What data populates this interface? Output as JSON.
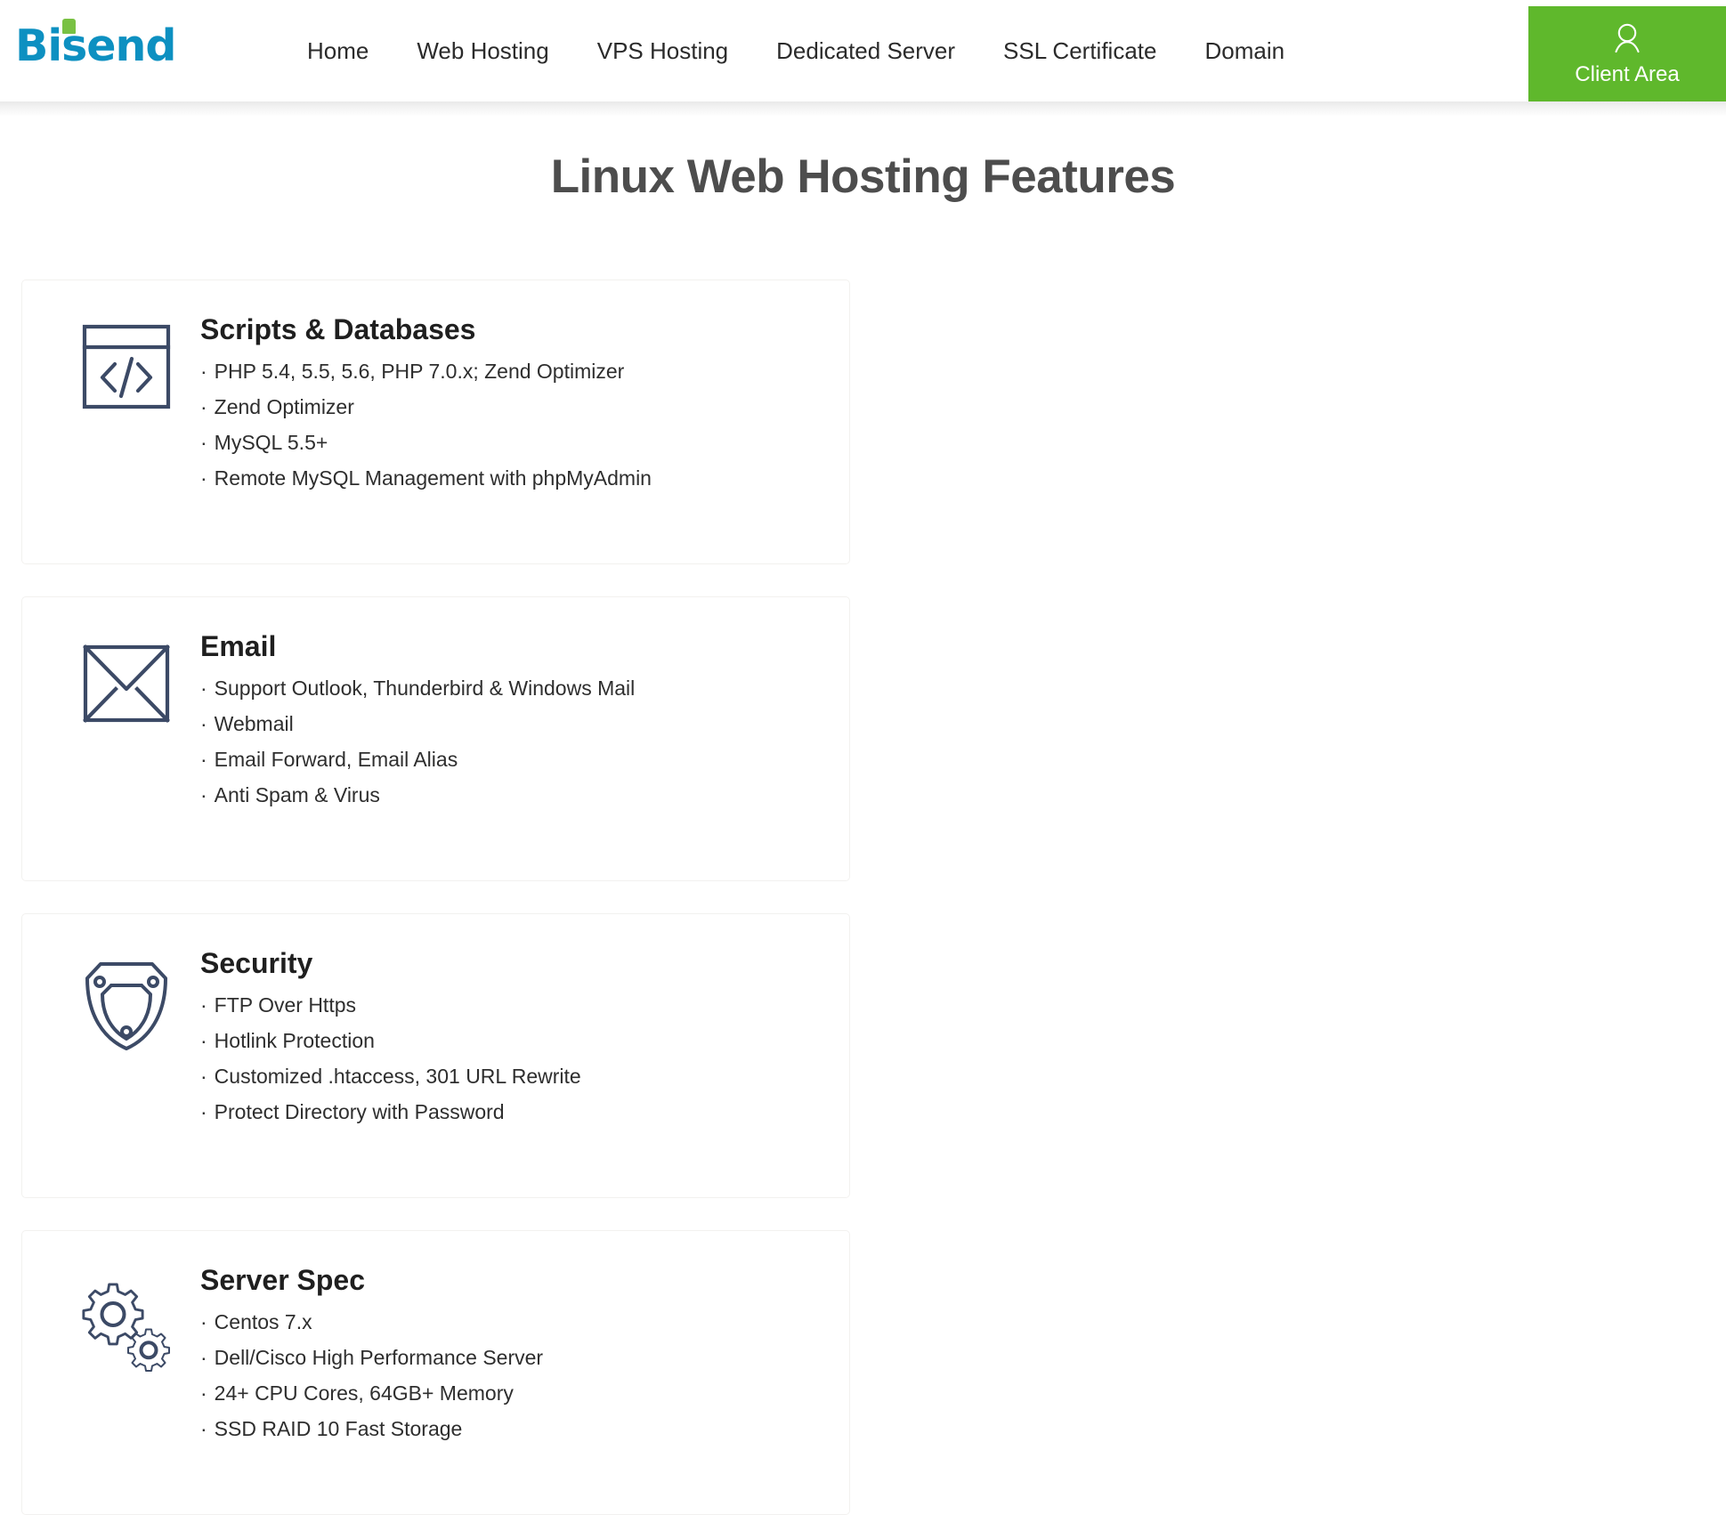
{
  "brand": {
    "logo_text": "Bisend",
    "logo_color": "#0d90c1",
    "accent_color": "#79c143"
  },
  "header": {
    "nav_items": [
      {
        "label": "Home",
        "name": "home"
      },
      {
        "label": "Web Hosting",
        "name": "web-hosting"
      },
      {
        "label": "VPS Hosting",
        "name": "vps-hosting"
      },
      {
        "label": "Dedicated Server",
        "name": "dedicated-server"
      },
      {
        "label": "SSL Certificate",
        "name": "ssl-certificate"
      },
      {
        "label": "Domain",
        "name": "domain"
      }
    ],
    "client_area": {
      "label": "Client Area",
      "icon": "user-icon",
      "background": "#5fb82c"
    }
  },
  "main": {
    "title": "Linux Web Hosting Features",
    "title_color": "#4d4d4d",
    "bullet": "·",
    "icon_color": "#3c4a66",
    "cards": [
      {
        "icon": "code-window-icon",
        "title": "Scripts & Databases",
        "items": [
          "PHP 5.4, 5.5, 5.6, PHP 7.0.x; Zend Optimizer",
          "Zend Optimizer",
          "MySQL 5.5+",
          "Remote MySQL Management with phpMyAdmin"
        ]
      },
      {
        "icon": "envelope-icon",
        "title": "Email",
        "items": [
          "Support Outlook, Thunderbird & Windows Mail",
          "Webmail",
          "Email Forward, Email Alias",
          "Anti Spam & Virus"
        ]
      },
      {
        "icon": "shield-icon",
        "title": "Security",
        "items": [
          "FTP Over Https",
          "Hotlink Protection",
          "Customized .htaccess, 301 URL Rewrite",
          "Protect Directory with Password"
        ]
      },
      {
        "icon": "gears-icon",
        "title": "Server Spec",
        "items": [
          "Centos 7.x",
          "Dell/Cisco High Performance Server",
          "24+ CPU Cores, 64GB+ Memory",
          "SSD RAID 10 Fast Storage"
        ]
      }
    ]
  }
}
